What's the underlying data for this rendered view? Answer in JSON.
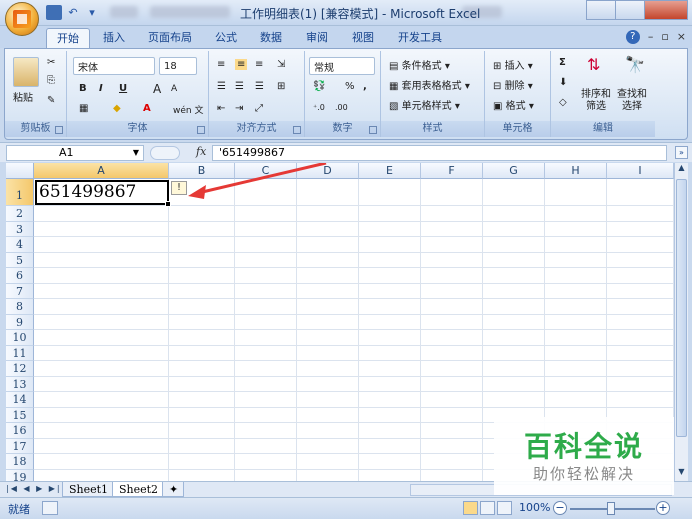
{
  "title_bar": {
    "title": "工作明细表(1)  [兼容模式] - Microsoft Excel"
  },
  "tabs": [
    "开始",
    "插入",
    "页面布局",
    "公式",
    "数据",
    "审阅",
    "视图",
    "开发工具"
  ],
  "ribbon": {
    "clipboard": {
      "paste": "粘贴",
      "label": "剪贴板"
    },
    "font": {
      "name": "宋体",
      "size": "18",
      "bold": "B",
      "italic": "I",
      "underline": "U",
      "grow": "A",
      "shrink": "A",
      "wen": "wén 文",
      "label": "字体"
    },
    "alignment": {
      "label": "对齐方式"
    },
    "number": {
      "format": "常规",
      "percent": "%",
      "comma": ",",
      "label": "数字"
    },
    "styles": {
      "conditional": "条件格式",
      "table": "套用表格格式",
      "cell": "单元格样式",
      "label": "样式"
    },
    "cells": {
      "insert": "插入",
      "delete": "删除",
      "format": "格式",
      "label": "单元格"
    },
    "editing": {
      "sort": "排序和\n筛选",
      "find": "查找和\n选择",
      "label": "编辑",
      "sum": "Σ"
    }
  },
  "formula_bar": {
    "name_box": "A1",
    "fx": "fx",
    "content": "'651499867"
  },
  "grid": {
    "columns": [
      "A",
      "B",
      "C",
      "D",
      "E",
      "F",
      "G",
      "H",
      "I"
    ],
    "rows": [
      "1",
      "2",
      "3",
      "4",
      "5",
      "6",
      "7",
      "8",
      "9",
      "10",
      "11",
      "12",
      "13",
      "14",
      "15",
      "16",
      "17",
      "18",
      "19"
    ],
    "cell_a1": "651499867",
    "warning_icon": "!"
  },
  "sheets": [
    "Sheet1",
    "Sheet2"
  ],
  "status": {
    "ready": "就绪",
    "zoom": "100%"
  },
  "watermark": {
    "top": "百科全说",
    "bottom": "助你轻松解决"
  },
  "colors": {
    "accent": "#15428b",
    "arrow": "#e53935",
    "watermark_green": "#2eab4a"
  }
}
